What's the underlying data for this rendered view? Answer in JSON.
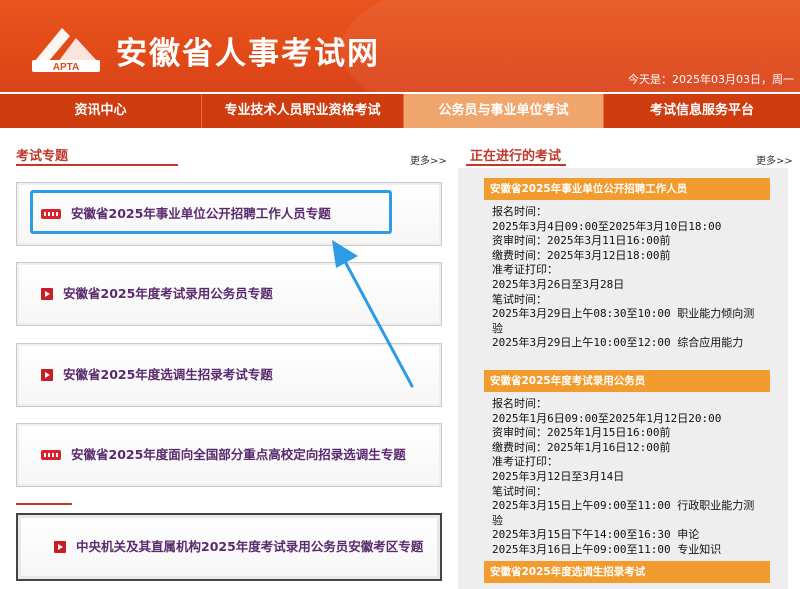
{
  "header": {
    "logo_text": "APTA",
    "site_title": "安徽省人事考试网",
    "today": "今天是：2025年03月03日，周一"
  },
  "nav": [
    {
      "label": "资讯中心"
    },
    {
      "label": "专业技术人员职业资格考试"
    },
    {
      "label": "公务员与事业单位考试",
      "active": true
    },
    {
      "label": "考试信息服务平台"
    }
  ],
  "left": {
    "heading": "考试专题",
    "more": "更多>>",
    "topics": [
      {
        "icon": "new-badge-icon",
        "label": "安徽省2025年事业单位公开招聘工作人员专题"
      },
      {
        "icon": "play-icon",
        "label": "安徽省2025年度考试录用公务员专题"
      },
      {
        "icon": "play-icon",
        "label": "安徽省2025年度选调生招录考试专题"
      },
      {
        "icon": "new-badge-icon",
        "label": "安徽省2025年度面向全国部分重点高校定向招录选调生专题"
      },
      {
        "icon": "play-icon",
        "label": "中央机关及其直属机构2025年度考试录用公务员安徽考区专题"
      }
    ]
  },
  "right": {
    "heading": "正在进行的考试",
    "more": "更多>>",
    "exams": [
      {
        "title": "安徽省2025年事业单位公开招聘工作人员",
        "lines": [
          "报名时间：",
          "2025年3月4日09:00至2025年3月10日18:00",
          "资审时间：2025年3月11日16:00前",
          "缴费时间：2025年3月12日18:00前",
          "准考证打印：",
          "2025年3月26日至3月28日",
          "笔试时间：",
          "2025年3月29日上午08:30至10:00 职业能力倾向测",
          "验",
          "2025年3月29日上午10:00至12:00 综合应用能力"
        ]
      },
      {
        "title": "安徽省2025年度考试录用公务员",
        "lines": [
          "报名时间：",
          "2025年1月6日09:00至2025年1月12日20:00",
          "资审时间：2025年1月15日16:00前",
          "缴费时间：2025年1月16日12:00前",
          "准考证打印：",
          "2025年3月12日至3月14日",
          "笔试时间：",
          "2025年3月15日上午09:00至11:00 行政职业能力测",
          "验",
          "2025年3月15日下午14:00至16:30 申论",
          "2025年3月16日上午09:00至11:00 专业知识"
        ]
      },
      {
        "title": "安徽省2025年度选调生招录考试",
        "lines": []
      }
    ]
  },
  "colors": {
    "header_orange": "#e14a17",
    "nav_red": "#cf3c10",
    "nav_active": "#f0a56c",
    "exam_bar": "#f29b2f",
    "highlight_blue": "#2e9be6",
    "heading_red": "#c0392b"
  }
}
